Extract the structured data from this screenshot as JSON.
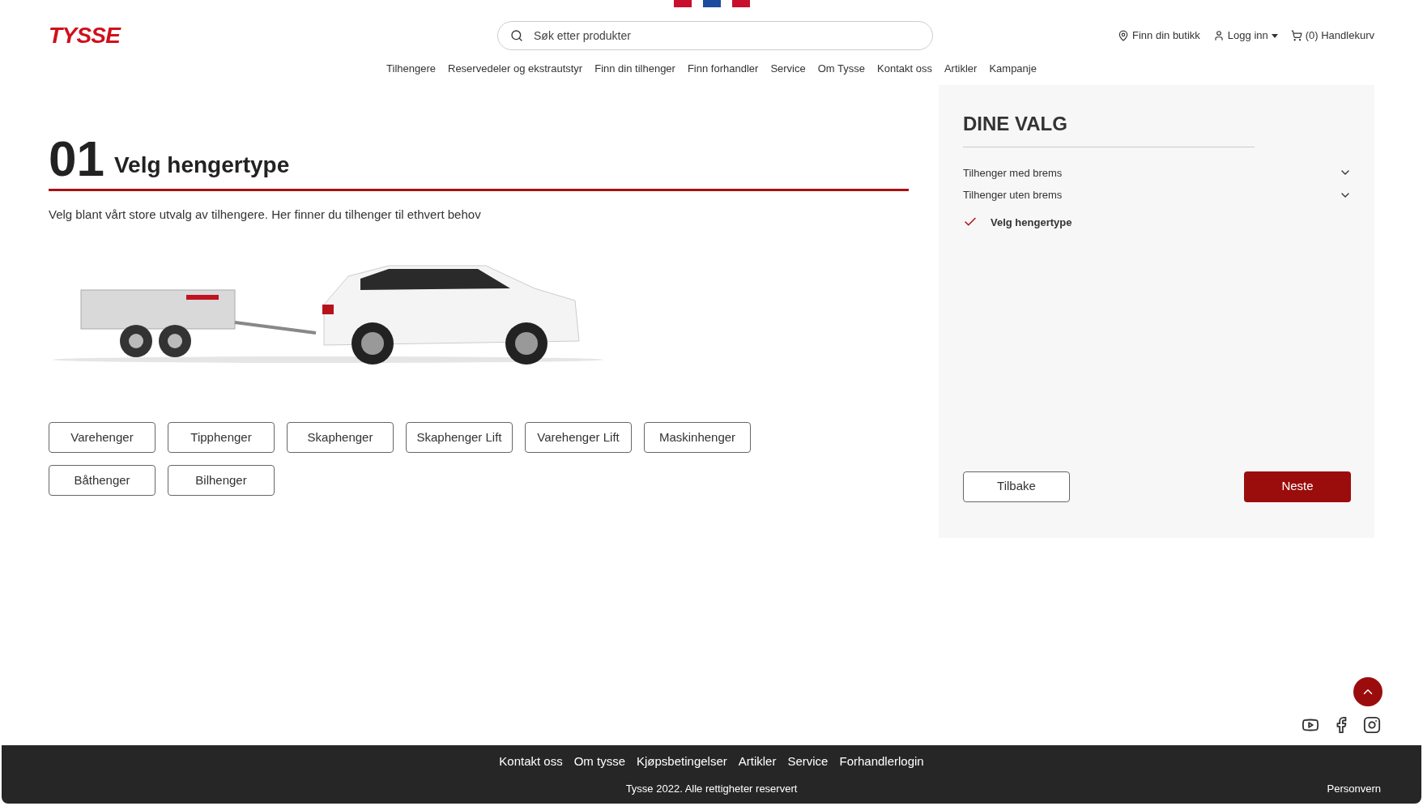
{
  "header": {
    "logo": "TYSSE",
    "search": {
      "placeholder": "Søk etter produkter"
    },
    "links": [
      {
        "kind": "store",
        "label": "Finn din butikk"
      },
      {
        "kind": "login",
        "label": "Logg inn"
      },
      {
        "kind": "cart",
        "label": "(0) Handlekurv"
      }
    ]
  },
  "nav": [
    "Tilhengere",
    "Reservedeler og ekstrautstyr",
    "Finn din tilhenger",
    "Finn forhandler",
    "Service",
    "Om Tysse",
    "Kontakt oss",
    "Artikler",
    "Kampanje"
  ],
  "step": {
    "number": "01",
    "title": "Velg hengertype",
    "description": "Velg blant vårt store utvalg av tilhengere. Her finner du tilhenger til ethvert behov"
  },
  "types": [
    {
      "label": "Varehenger",
      "selected": false
    },
    {
      "label": "Tipphenger",
      "selected": false
    },
    {
      "label": "Skaphenger",
      "selected": false
    },
    {
      "label": "Skaphenger Lift",
      "selected": false
    },
    {
      "label": "Varehenger Lift",
      "selected": false
    },
    {
      "label": "Maskinhenger",
      "selected": false
    },
    {
      "label": "Båthenger",
      "selected": false
    },
    {
      "label": "Bilhenger",
      "selected": false
    }
  ],
  "summary": {
    "title": "DINE VALG",
    "groups": [
      {
        "label": "Tilhenger med brems",
        "expanded": false
      },
      {
        "label": "Tilhenger uten brems",
        "expanded": false
      }
    ],
    "steps": [
      {
        "label": "Velg hengertype",
        "done": true
      }
    ],
    "back": "Tilbake",
    "next": "Neste"
  },
  "footer": {
    "links": [
      "Kontakt oss",
      "Om tysse",
      "Kjøpsbetingelser",
      "Artikler",
      "Service",
      "Forhandlerlogin"
    ],
    "copyright": "Tysse 2022. Alle rettigheter reservert",
    "privacy": "Personvern"
  }
}
